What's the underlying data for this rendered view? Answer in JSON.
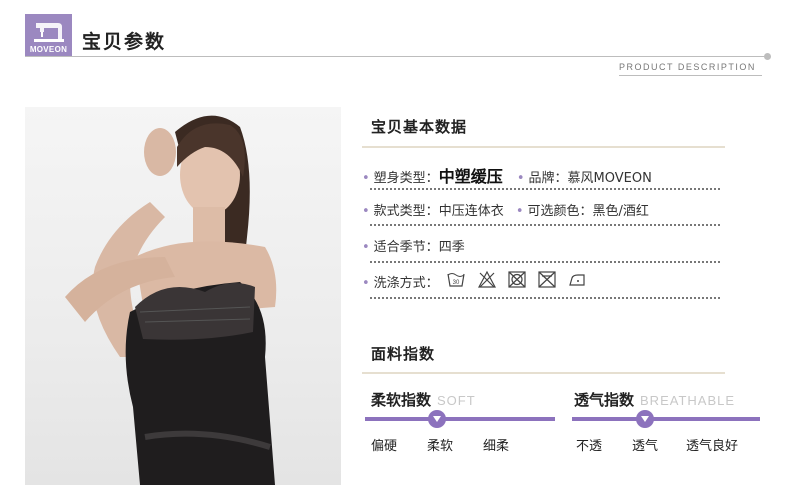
{
  "header": {
    "logo_text": "MOVEON",
    "title": "宝贝参数",
    "subtitle": "PRODUCT DESCRIPTION"
  },
  "basic": {
    "title": "宝贝基本数据",
    "rows": [
      {
        "label": "塑身类型：",
        "value": "中塑缓压",
        "label2": "品牌：",
        "value2": "慕风MOVEON"
      },
      {
        "label": "款式类型：",
        "value": "中压连体衣",
        "label2": "可选颜色：",
        "value2": "黑色/酒红"
      },
      {
        "label": "适合季节：",
        "value": "四季"
      },
      {
        "label": "洗涤方式："
      }
    ],
    "wash_icons": [
      "wash-30-icon",
      "no-bleach-icon",
      "no-tumble-dry-icon",
      "no-dry-clean-icon",
      "low-iron-icon"
    ],
    "wash_temp": "30"
  },
  "fabric": {
    "title": "面料指数",
    "softness": {
      "title": "柔软指数",
      "en": "SOFT",
      "levels": [
        "偏硬",
        "柔软",
        "细柔"
      ],
      "selected": 1
    },
    "breathability": {
      "title": "透气指数",
      "en": "BREATHABLE",
      "levels": [
        "不透",
        "透气",
        "透气良好"
      ],
      "selected": 1
    }
  },
  "colors": {
    "accent": "#8c72bd",
    "logo_bg": "#9b88c0",
    "rule": "#e6dfd0"
  }
}
